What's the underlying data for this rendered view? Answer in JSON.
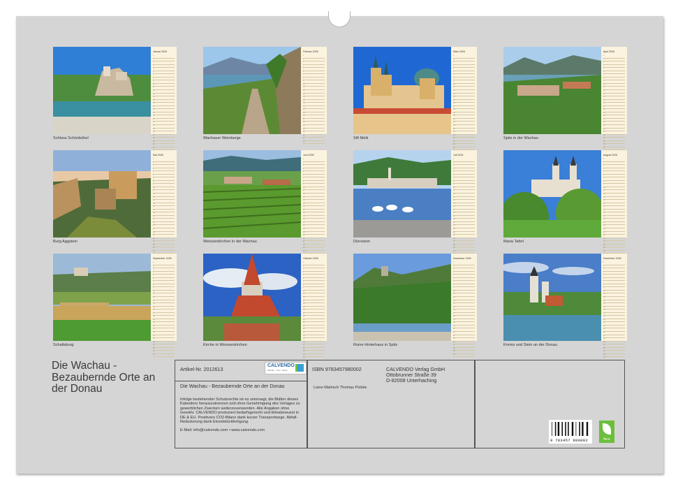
{
  "calendar": {
    "title": "Die Wachau - Bezaubernde Orte an der Donau",
    "year_label": "2026",
    "months": [
      {
        "name": "Januar",
        "caption": "Schloss Schönbühel",
        "days": 31,
        "scene": "castle-river"
      },
      {
        "name": "Februar",
        "caption": "Wachauer Weinberge",
        "days": 28,
        "scene": "vineyard-path"
      },
      {
        "name": "März",
        "caption": "Sift Melk",
        "days": 31,
        "scene": "abbey"
      },
      {
        "name": "April",
        "caption": "Spitz in der Wachau",
        "days": 30,
        "scene": "valley-town"
      },
      {
        "name": "Mai",
        "caption": "Burg Aggstein",
        "days": 31,
        "scene": "ruin-sunset"
      },
      {
        "name": "Juni",
        "caption": "Weissenkirchen in der Wachau",
        "days": 30,
        "scene": "vineyard-rows"
      },
      {
        "name": "Juli",
        "caption": "Dürnstein",
        "days": 31,
        "scene": "swans"
      },
      {
        "name": "August",
        "caption": "Maria Taferl",
        "days": 31,
        "scene": "basilica-hill"
      },
      {
        "name": "September",
        "caption": "Schallaburg",
        "days": 30,
        "scene": "fields"
      },
      {
        "name": "Oktober",
        "caption": "Kirche in Weissenkirchen",
        "days": 31,
        "scene": "church-clouds"
      },
      {
        "name": "November",
        "caption": "Ruine Hinterhaus in Spitz",
        "days": 30,
        "scene": "ruin-hill"
      },
      {
        "name": "Dezember",
        "caption": "Krems und Stein an der Donau",
        "days": 31,
        "scene": "krems"
      }
    ]
  },
  "info": {
    "article_label": "Artikel-Nr. 2012613",
    "product_title": "Die Wachau - Bezaubernde Orte an der Donau",
    "legal_text": "Infolge bestehender Schutzrechte ist es untersagt, die Blätter dieses Kalenders herauszutrennen und ohne Genehmigung des Verlages zu gewerblichen Zwecken weiterzuverwenden. Alle Angaben ohne Gewähr. CALVENDO produziert bedarfsgerecht und klimabewusst in DE & EU. Positivere CO2-Bilanz dank kurzer Transportwege. Abfall-Reduzierung dank Einzelstückfertigung.",
    "email_line": "E-Mail: info@calvendo.com • www.calvendo.com",
    "isbn": "ISBN 9783457980002",
    "authors": "Liane Matrisch Thomas Polske",
    "publisher_lines": [
      "CALVENDO Verlag GmbH",
      "Ottobrunner Straße 39",
      "D-82008 Unterhaching"
    ],
    "logo_text": "CALVENDO",
    "logo_sub": "Kalender · Kunst · Design",
    "barcode_digits": "9 783457 980002",
    "eco_label": "feco"
  }
}
